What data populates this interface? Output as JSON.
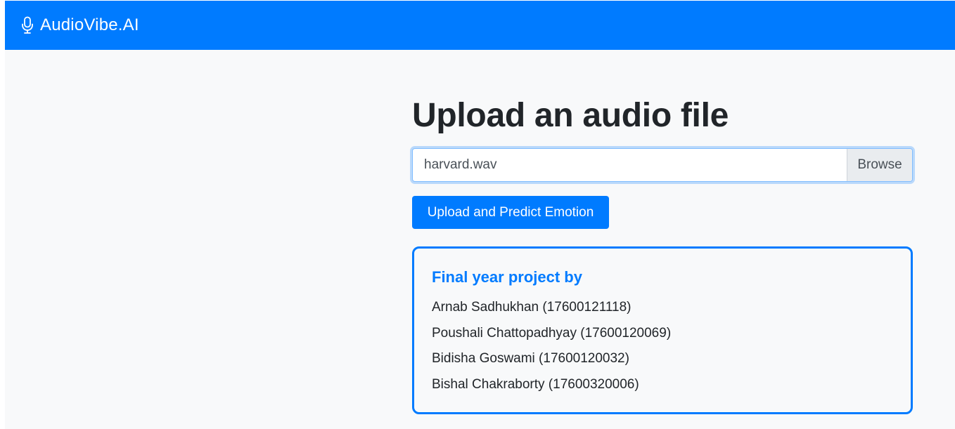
{
  "navbar": {
    "brand": "AudioVibe.AI",
    "brand_icon": "microphone-icon",
    "background": "#007bff"
  },
  "main": {
    "heading": "Upload an audio file",
    "file_input": {
      "value": "harvard.wav",
      "browse_label": "Browse"
    },
    "submit_label": "Upload and Predict Emotion"
  },
  "credits": {
    "title": "Final year project by",
    "members": [
      "Arnab Sadhukhan (17600121118)",
      "Poushali Chattopadhyay (17600120069)",
      "Bidisha Goswami (17600120032)",
      "Bishal Chakraborty (17600320006)"
    ],
    "accent": "#007bff"
  }
}
